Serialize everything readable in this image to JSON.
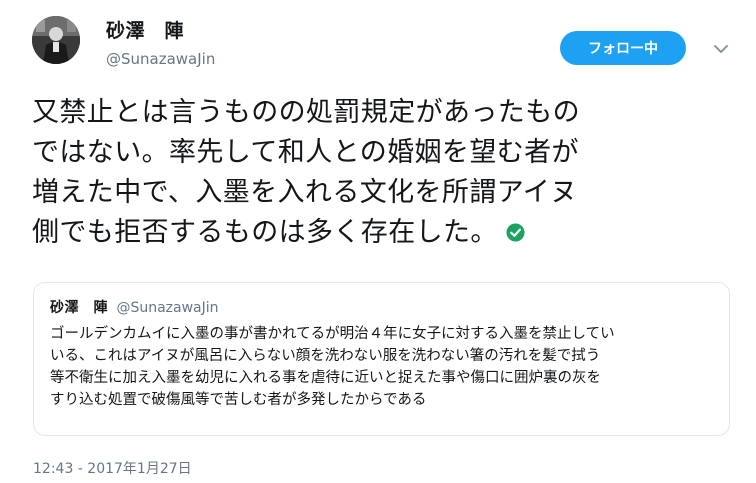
{
  "author": {
    "name": "砂澤　陣",
    "handle": "@SunazawaJin"
  },
  "follow_button": {
    "label": "フォロー中"
  },
  "menu": {
    "icon": "chevron-down-icon"
  },
  "tweet": {
    "lines": [
      "又禁止とは言うものの処罰規定があったもの",
      "ではない。率先して和人との婚姻を望む者が",
      "増えた中で、入墨を入れる文化を所謂アイヌ",
      "側でも拒否するものは多く存在した。"
    ],
    "emoji": "check-mark-button-icon"
  },
  "quoted_tweet": {
    "name": "砂澤　陣",
    "handle": "@SunazawaJin",
    "lines": [
      "ゴールデンカムイに入墨の事が書かれてるが明治４年に女子に対する入墨を禁止してい",
      "いる、これはアイヌが風呂に入らない顔を洗わない服を洗わない箸の汚れを髪で拭う",
      "等不衛生に加え入墨を幼児に入れる事を虐待に近いと捉えた事や傷口に囲炉裏の灰を",
      "すり込む処置で破傷風等で苦しむ者が多発したからである"
    ]
  },
  "timestamp": "12:43 - 2017年1月27日",
  "colors": {
    "accent": "#1da1f2",
    "text": "#14171a",
    "muted": "#657786",
    "border": "#e1e8ed",
    "check": "#1aa260"
  }
}
